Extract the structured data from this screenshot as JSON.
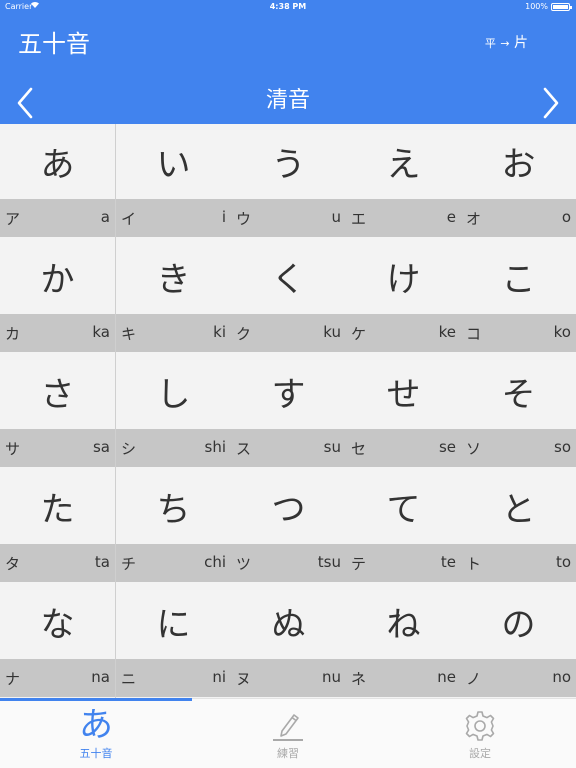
{
  "status_bar": {
    "carrier": "Carrier",
    "time": "4:38 PM",
    "battery": "100%"
  },
  "header": {
    "app_title": "五十音",
    "toggle_from": "平",
    "toggle_arrow": "→",
    "toggle_to": "片",
    "section_title": "清音",
    "prev_icon": "chevron-left-icon",
    "next_icon": "chevron-right-icon"
  },
  "kana_rows": [
    [
      {
        "hira": "あ",
        "kata": "ア",
        "romaji": "a"
      },
      {
        "hira": "い",
        "kata": "イ",
        "romaji": "i"
      },
      {
        "hira": "う",
        "kata": "ウ",
        "romaji": "u"
      },
      {
        "hira": "え",
        "kata": "エ",
        "romaji": "e"
      },
      {
        "hira": "お",
        "kata": "オ",
        "romaji": "o"
      }
    ],
    [
      {
        "hira": "か",
        "kata": "カ",
        "romaji": "ka"
      },
      {
        "hira": "き",
        "kata": "キ",
        "romaji": "ki"
      },
      {
        "hira": "く",
        "kata": "ク",
        "romaji": "ku"
      },
      {
        "hira": "け",
        "kata": "ケ",
        "romaji": "ke"
      },
      {
        "hira": "こ",
        "kata": "コ",
        "romaji": "ko"
      }
    ],
    [
      {
        "hira": "さ",
        "kata": "サ",
        "romaji": "sa"
      },
      {
        "hira": "し",
        "kata": "シ",
        "romaji": "shi"
      },
      {
        "hira": "す",
        "kata": "ス",
        "romaji": "su"
      },
      {
        "hira": "せ",
        "kata": "セ",
        "romaji": "se"
      },
      {
        "hira": "そ",
        "kata": "ソ",
        "romaji": "so"
      }
    ],
    [
      {
        "hira": "た",
        "kata": "タ",
        "romaji": "ta"
      },
      {
        "hira": "ち",
        "kata": "チ",
        "romaji": "chi"
      },
      {
        "hira": "つ",
        "kata": "ツ",
        "romaji": "tsu"
      },
      {
        "hira": "て",
        "kata": "テ",
        "romaji": "te"
      },
      {
        "hira": "と",
        "kata": "ト",
        "romaji": "to"
      }
    ],
    [
      {
        "hira": "な",
        "kata": "ナ",
        "romaji": "na"
      },
      {
        "hira": "に",
        "kata": "ニ",
        "romaji": "ni"
      },
      {
        "hira": "ぬ",
        "kata": "ヌ",
        "romaji": "nu"
      },
      {
        "hira": "ね",
        "kata": "ネ",
        "romaji": "ne"
      },
      {
        "hira": "の",
        "kata": "ノ",
        "romaji": "no"
      }
    ]
  ],
  "tabbar": {
    "tabs": [
      {
        "glyph": "あ",
        "label": "五十音",
        "icon": "hiragana-a-icon",
        "active": true
      },
      {
        "glyph": "",
        "label": "練習",
        "icon": "pencil-icon",
        "active": false
      },
      {
        "glyph": "",
        "label": "設定",
        "icon": "gear-icon",
        "active": false
      }
    ]
  },
  "colors": {
    "accent": "#4183EE",
    "cell_background": "#F3F3F3",
    "band_background": "#C6C6C6",
    "inactive_tab": "#A9A9A9"
  }
}
